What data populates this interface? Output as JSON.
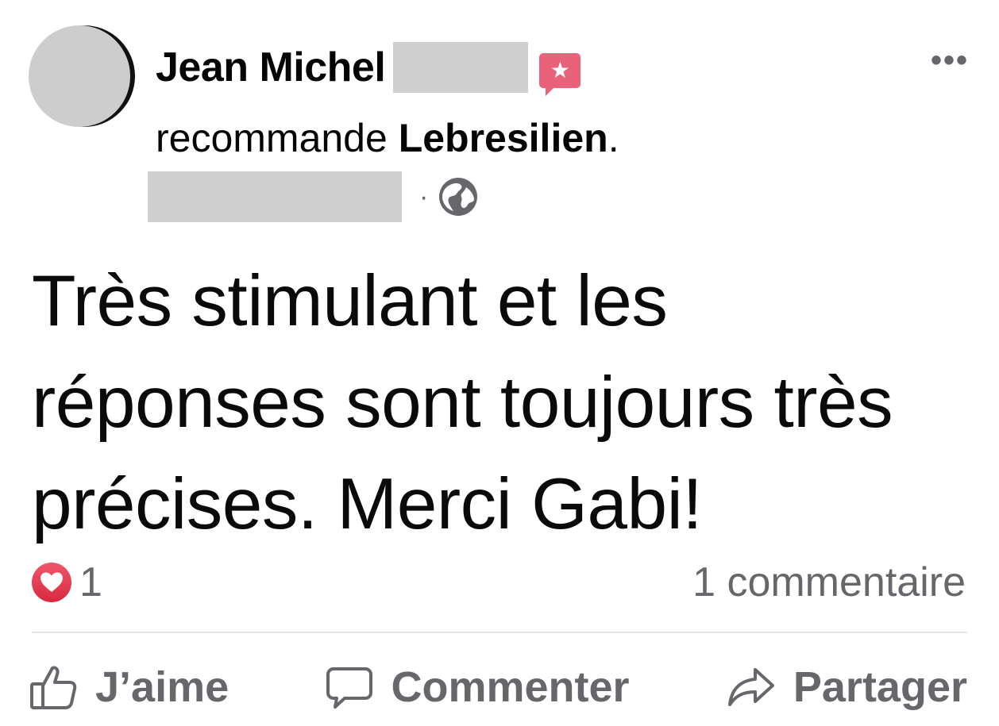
{
  "post": {
    "author_name": "Jean Michel",
    "recommend_verb": "recommande",
    "page_name": "Lebresilien",
    "recommend_punct": ".",
    "meta_separator": "·",
    "text": "Très stimulant et les réponses sont toujours très précises. Merci Gabi!",
    "reactions_count": "1",
    "comments_label": "1 commentaire"
  },
  "icons": {
    "recommend": "star-badge-icon",
    "privacy": "globe-icon",
    "reaction": "heart-icon",
    "more": "more-options-icon",
    "like": "thumbs-up-icon",
    "comment": "speech-bubble-icon",
    "share": "share-arrow-icon"
  },
  "actions": {
    "like_label": "J’aime",
    "comment_label": "Commenter",
    "share_label": "Partager"
  },
  "colors": {
    "recommend_badge": "#e8627a",
    "heart": "#e63950",
    "secondary_text": "#65676b"
  }
}
